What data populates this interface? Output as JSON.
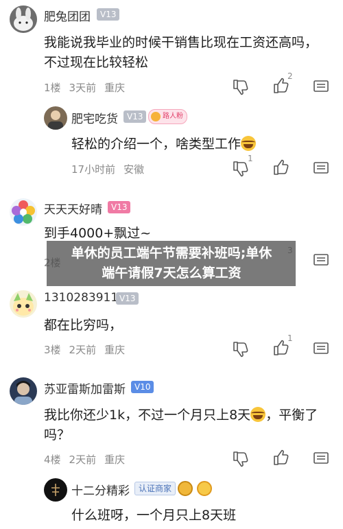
{
  "comments": [
    {
      "username": "肥兔团团",
      "level": "V13",
      "text_line1": "我能说我毕业的时候干销售比现在工资还高吗，",
      "text_line2": "不过现在比较轻松",
      "floor": "1楼",
      "time": "3天前",
      "location": "重庆",
      "like_count": "2",
      "reply": {
        "username": "肥宅吃货",
        "level": "V13",
        "tag": "路人粉",
        "text": "轻松的介绍一个，啥类型工作",
        "time": "17小时前",
        "location": "安徽",
        "dislike_count": "1"
      }
    },
    {
      "username": "天天天好晴",
      "level": "V13",
      "text": "到手4000+飘过~",
      "floor": "2楼",
      "like_count": "3"
    },
    {
      "username": "1310283911",
      "level": "V13",
      "text": "都在比穷吗，",
      "floor": "3楼",
      "time": "2天前",
      "location": "重庆",
      "like_count": "1"
    },
    {
      "username": "苏亚雷斯加雷斯",
      "level": "V10",
      "text_line1": "我比你还少1k，不过一个月只上8天",
      "text_line1_end": "，平衡了",
      "text_line2": "吗？",
      "floor": "4楼",
      "time": "2天前",
      "location": "重庆",
      "reply": {
        "username": "十二分精彩",
        "badge": "认证商家",
        "text": "什么班呀，一个月只上8天班"
      }
    }
  ],
  "overlay": {
    "line1": "单休的员工端午节需要补班吗;单休",
    "line2": "端午请假7天怎么算工资"
  },
  "colors": {
    "badge_gray": "#b9bec8",
    "badge_pink": "#f07aa4",
    "badge_blue": "#5b8de6",
    "overlay": "#464646"
  }
}
